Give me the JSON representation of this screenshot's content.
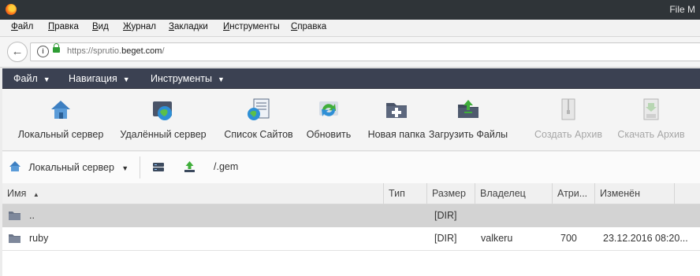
{
  "window": {
    "title": "File M"
  },
  "browser_menu": [
    "Файл",
    "Правка",
    "Вид",
    "Журнал",
    "Закладки",
    "Инструменты",
    "Справка"
  ],
  "address": {
    "prefix": "https://sprutio.",
    "domain": "beget.com",
    "suffix": "/"
  },
  "app_menu": [
    "Файл",
    "Навигация",
    "Инструменты"
  ],
  "toolbar": [
    {
      "label": "Локальный сервер",
      "icon": "home-server-icon",
      "disabled": false
    },
    {
      "label": "Удалённый сервер",
      "icon": "remote-server-icon",
      "disabled": false
    },
    {
      "label": "Список Сайтов",
      "icon": "sites-list-icon",
      "disabled": false
    },
    {
      "label": "Обновить",
      "icon": "refresh-icon",
      "disabled": false
    },
    {
      "label": "Новая папка",
      "icon": "new-folder-icon",
      "disabled": false
    },
    {
      "label": "Загрузить Файлы",
      "icon": "upload-files-icon",
      "disabled": false
    },
    {
      "label": "Создать Архив",
      "icon": "create-archive-icon",
      "disabled": true
    },
    {
      "label": "Скачать Архив",
      "icon": "download-archive-icon",
      "disabled": true
    }
  ],
  "path_bar": {
    "server_label": "Локальный сервер",
    "path": "/.gem"
  },
  "columns": [
    "Имя",
    "Тип",
    "Размер",
    "Владелец",
    "Атри...",
    "Изменён"
  ],
  "rows": [
    {
      "name": "..",
      "type": "",
      "size": "[DIR]",
      "owner": "",
      "attrs": "",
      "modified": ""
    },
    {
      "name": "ruby",
      "type": "",
      "size": "[DIR]",
      "owner": "valkeru",
      "attrs": "700",
      "modified": "23.12.2016 08:20..."
    }
  ],
  "colors": {
    "app_menu_bg": "#3b4152",
    "selected_row": "#d3d3d3",
    "lock_green": "#2e9d34"
  }
}
